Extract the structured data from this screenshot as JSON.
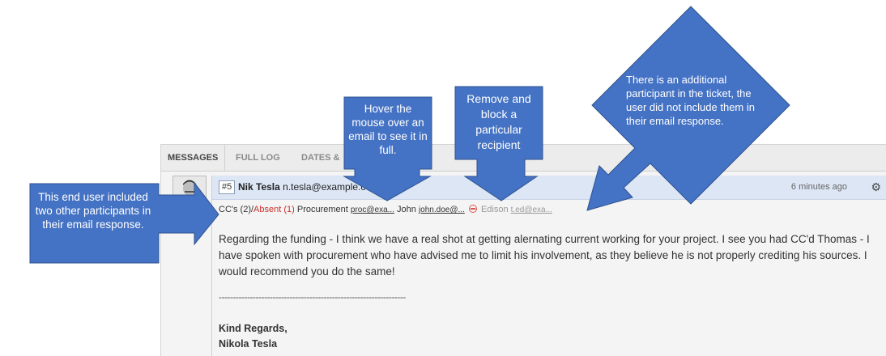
{
  "tabs": [
    "MESSAGES",
    "FULL LOG",
    "DATES &"
  ],
  "message": {
    "number": "#5",
    "sender_name": "Nik Tesla",
    "sender_email": "n.tesla@example.c",
    "time": "6 minutes ago",
    "cc_prefix": "CC's (2)/",
    "cc_absent": "Absent (1)",
    "recipients": [
      {
        "name": "Procurement",
        "email": "proc@exa..."
      },
      {
        "name": "John",
        "email": "john.doe@..."
      },
      {
        "name": "Edison",
        "email": "t.ed@exa..."
      }
    ],
    "body": "Regarding the funding - I think we have a real shot at getting alernating current working for your project. I see you had CC'd Thomas - I have spoken with procurement who have advised me to limit his involvement, as they believe he is not properly crediting his sources. I would recommend you do the same!",
    "divider": "------------------------------------------------------------------",
    "signature_line1": "Kind Regards,",
    "signature_line2": "Nikola Tesla"
  },
  "callouts": {
    "left": "This end user included two other participants in their email response.",
    "hover": "Hover the mouse over an email to see it in full.",
    "remove": "Remove and block a particular recipient",
    "diamond": "There is an additional participant in the ticket, the user did not include them in their email response."
  },
  "colors": {
    "callout": "#4472c4",
    "header": "#dce6f5",
    "absent": "#c9302c"
  }
}
